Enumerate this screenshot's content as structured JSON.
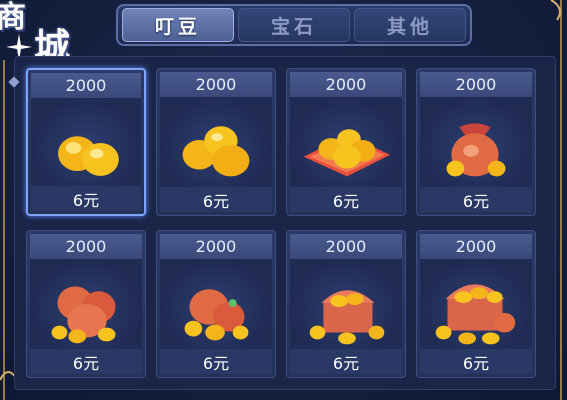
{
  "title": {
    "char1": "商",
    "char2": "城"
  },
  "tabs": [
    {
      "label": "叮豆",
      "active": true
    },
    {
      "label": "宝石",
      "active": false
    },
    {
      "label": "其他",
      "active": false
    }
  ],
  "items": [
    {
      "amount": "2000",
      "price": "6元",
      "image": "gold-beans-pair-icon"
    },
    {
      "amount": "2000",
      "price": "6元",
      "image": "gold-beans-trio-icon"
    },
    {
      "amount": "2000",
      "price": "6元",
      "image": "gold-beans-on-cloth-icon"
    },
    {
      "amount": "2000",
      "price": "6元",
      "image": "money-pouch-icon"
    },
    {
      "amount": "2000",
      "price": "6元",
      "image": "money-bags-pile-icon"
    },
    {
      "amount": "2000",
      "price": "6元",
      "image": "treasure-pouch-icon"
    },
    {
      "amount": "2000",
      "price": "6元",
      "image": "treasure-chest-icon"
    },
    {
      "amount": "2000",
      "price": "6元",
      "image": "treasure-chest-large-icon"
    }
  ],
  "colors": {
    "gold": "#f7c31f",
    "accent_selected": "#7fa6ff",
    "bag_red": "#e06a44"
  }
}
